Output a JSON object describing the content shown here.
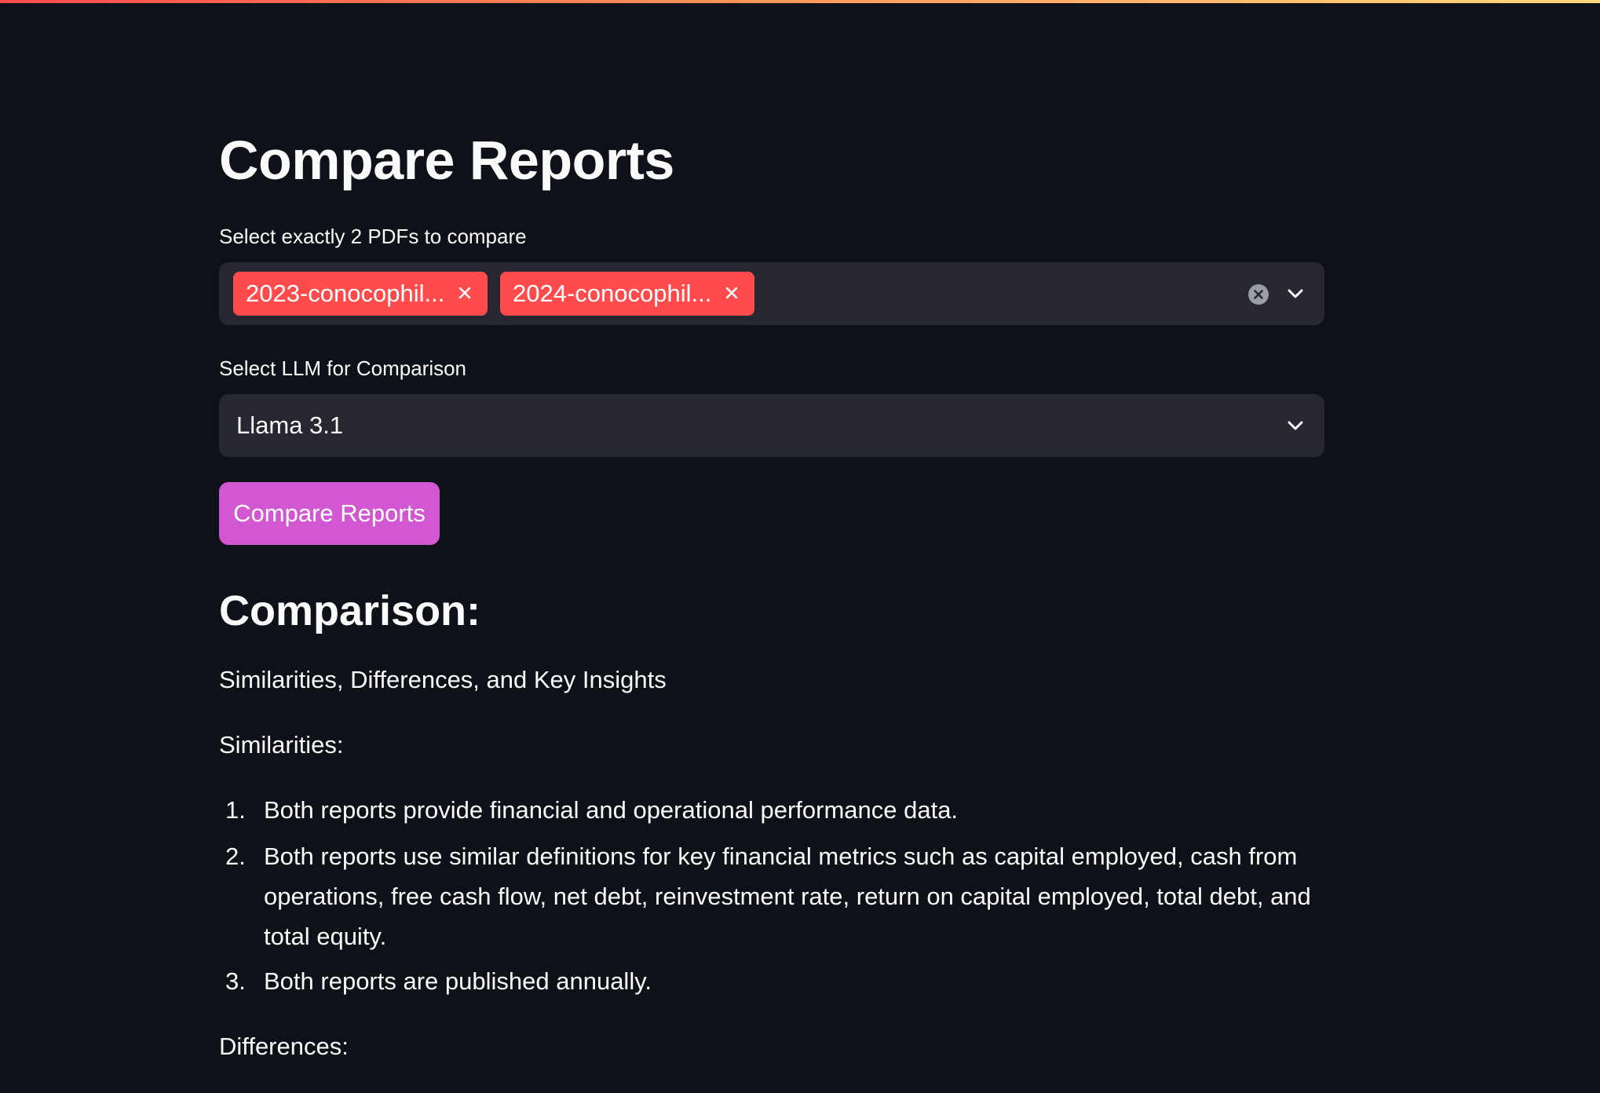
{
  "page": {
    "title": "Compare Reports"
  },
  "pdf_select": {
    "label": "Select exactly 2 PDFs to compare",
    "tags": [
      {
        "label": "2023-conocophil..."
      },
      {
        "label": "2024-conocophil..."
      }
    ]
  },
  "llm_select": {
    "label": "Select LLM for Comparison",
    "value": "Llama 3.1"
  },
  "compare_button": {
    "label": "Compare Reports"
  },
  "result": {
    "heading": "Comparison:",
    "intro": "Similarities, Differences, and Key Insights",
    "similarities_label": "Similarities:",
    "similarities": [
      {
        "num": "1.",
        "text": "Both reports provide financial and operational performance data."
      },
      {
        "num": "2.",
        "text": "Both reports use similar definitions for key financial metrics such as capital employed, cash from operations, free cash flow, net debt, reinvestment rate, return on capital employed, total debt, and total equity."
      },
      {
        "num": "3.",
        "text": "Both reports are published annually."
      }
    ],
    "differences_label": "Differences:"
  },
  "colors": {
    "background": "#0e1117",
    "input_background": "#262730",
    "tag": "#ff4b4b",
    "button": "#d158d0",
    "text": "#fafafa"
  },
  "icons": {
    "tag_remove": "close-icon",
    "clear_all": "clear-circle-icon",
    "dropdown": "chevron-down-icon"
  }
}
